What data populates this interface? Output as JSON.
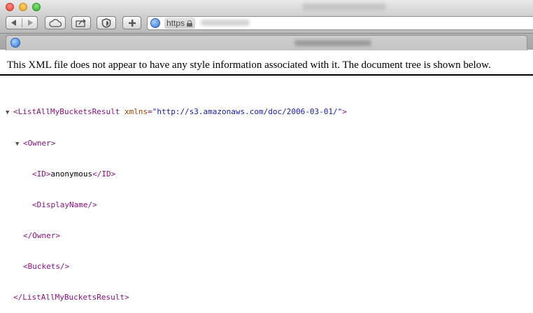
{
  "window": {
    "traffic_lights": [
      "close",
      "minimize",
      "zoom"
    ]
  },
  "toolbar": {
    "buttons": [
      "back",
      "forward",
      "icloud",
      "share",
      "reader",
      "new-tab"
    ],
    "address": {
      "scheme": "https",
      "secure": true
    }
  },
  "notice": "This XML file does not appear to have any style information associated with it. The document tree is shown below.",
  "tree": {
    "root_open": "<ListAllMyBucketsResult",
    "root_attr_name": "xmlns",
    "root_attr_eq": "=",
    "root_attr_value": "\"http://s3.amazonaws.com/doc/2006-03-01/\"",
    "root_open_end": ">",
    "owner_open": "<Owner>",
    "id_open": "<ID>",
    "id_value": "anonymous",
    "id_close": "</ID>",
    "display_name": "<DisplayName/>",
    "owner_close": "</Owner>",
    "buckets": "<Buckets/>",
    "root_close": "</ListAllMyBucketsResult>"
  },
  "colors": {
    "tag": "#881280",
    "attr_name": "#994500",
    "attr_value": "#1a1aa6"
  }
}
